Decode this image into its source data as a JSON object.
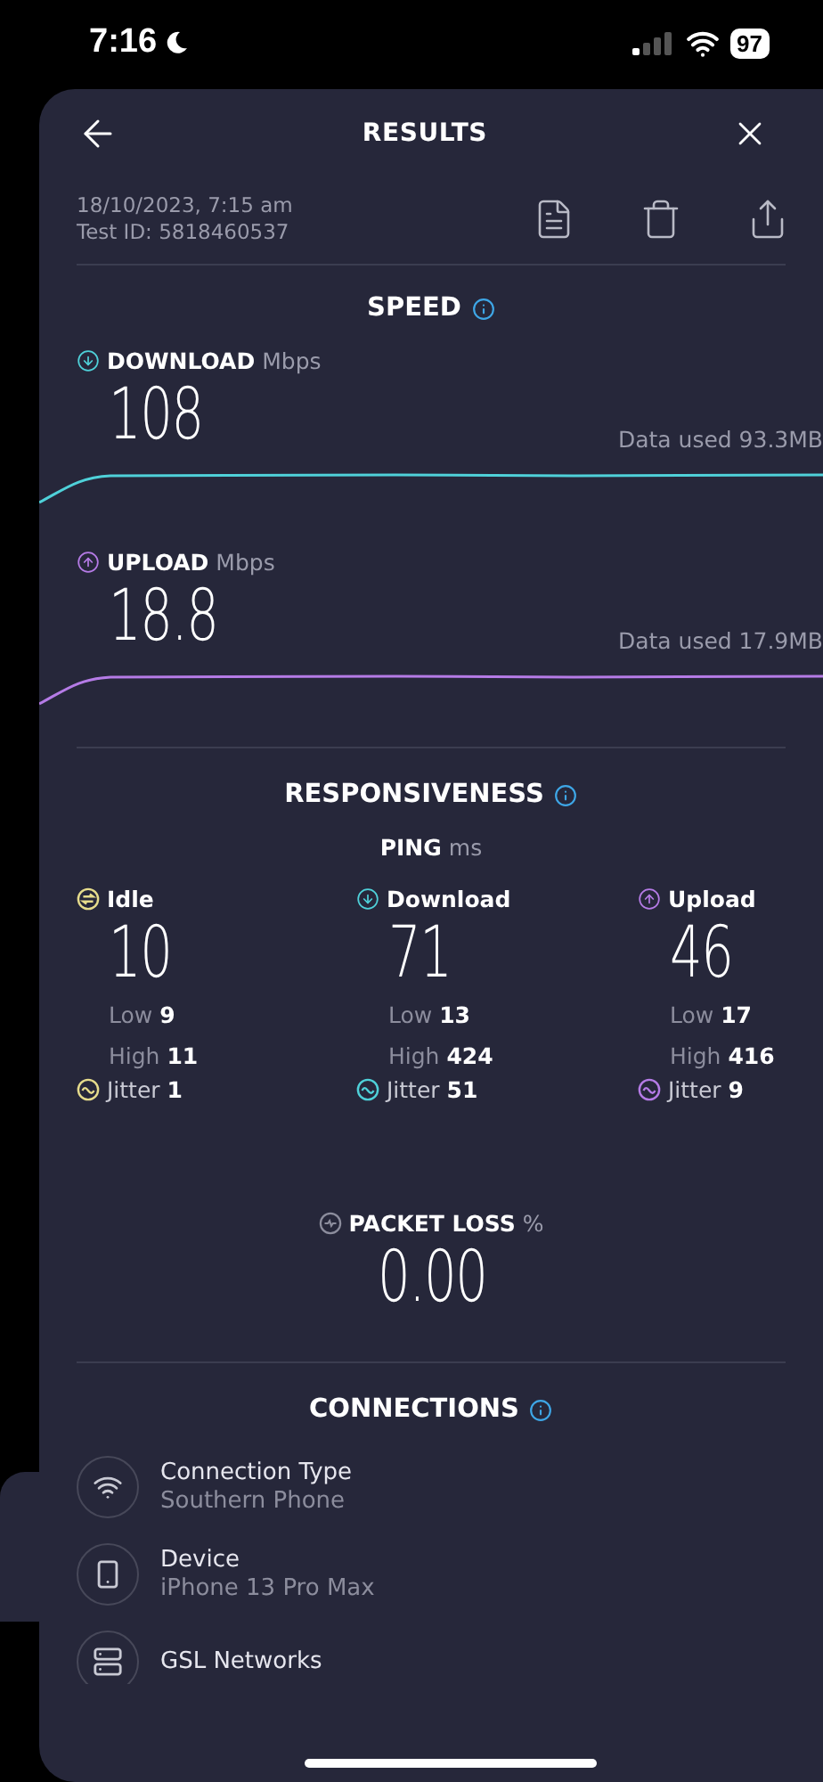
{
  "status_bar": {
    "time": "7:16",
    "battery": "97"
  },
  "header": {
    "title": "RESULTS"
  },
  "meta": {
    "date": "18/10/2023, 7:15 am",
    "test_id": "Test ID: 5818460537"
  },
  "speed": {
    "title": "SPEED",
    "metrics": [
      {
        "kind": "download",
        "label": "DOWNLOAD",
        "unit": "Mbps",
        "value": "108",
        "data_used": "Data used 93.3MB",
        "color": "#4fd1d9"
      },
      {
        "kind": "upload",
        "label": "UPLOAD",
        "unit": "Mbps",
        "value": "18.8",
        "data_used": "Data used 17.9MB",
        "color": "#b57be6"
      }
    ]
  },
  "responsiveness": {
    "title": "RESPONSIVENESS",
    "ping_label": "PING",
    "ping_unit": "ms",
    "columns": [
      {
        "kind": "idle",
        "label": "Idle",
        "value": "10",
        "low_label": "Low",
        "low": "9",
        "high_label": "High",
        "high": "11",
        "jitter_label": "Jitter",
        "jitter": "1",
        "color": "#e6dc8c"
      },
      {
        "kind": "download",
        "label": "Download",
        "value": "71",
        "low_label": "Low",
        "low": "13",
        "high_label": "High",
        "high": "424",
        "jitter_label": "Jitter",
        "jitter": "51",
        "color": "#4fd1d9"
      },
      {
        "kind": "upload",
        "label": "Upload",
        "value": "46",
        "low_label": "Low",
        "low": "17",
        "high_label": "High",
        "high": "416",
        "jitter_label": "Jitter",
        "jitter": "9",
        "color": "#b57be6"
      }
    ]
  },
  "packet_loss": {
    "label": "PACKET LOSS",
    "unit": "%",
    "value": "0.00"
  },
  "connections": {
    "title": "CONNECTIONS",
    "items": [
      {
        "kind": "wifi",
        "label": "Connection Type",
        "value": "Southern Phone"
      },
      {
        "kind": "phone",
        "label": "Device",
        "value": "iPhone 13 Pro Max"
      },
      {
        "kind": "server",
        "label": "GSL Networks"
      }
    ]
  }
}
